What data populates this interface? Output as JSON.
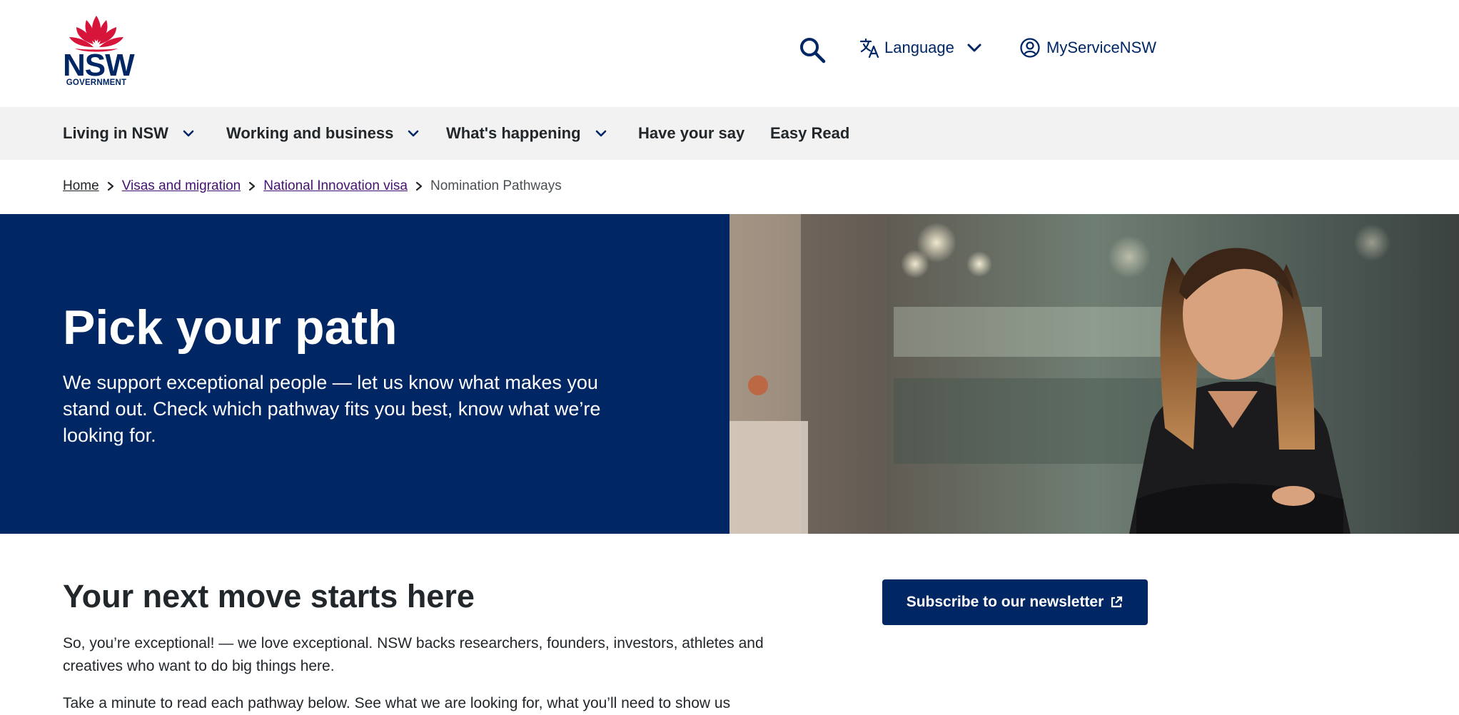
{
  "header": {
    "logo_text": "NSW",
    "logo_subtext": "GOVERNMENT",
    "language_label": "Language",
    "account_label": "MyServiceNSW"
  },
  "nav": {
    "items": [
      {
        "label": "Living in NSW",
        "has_dropdown": true
      },
      {
        "label": "Working and business",
        "has_dropdown": true
      },
      {
        "label": "What's happening",
        "has_dropdown": true
      },
      {
        "label": "Have your say",
        "has_dropdown": false
      },
      {
        "label": "Easy Read",
        "has_dropdown": false
      }
    ]
  },
  "breadcrumb": {
    "items": [
      "Home",
      "Visas and migration",
      "National Innovation visa"
    ],
    "current": "Nomination Pathways"
  },
  "hero": {
    "title": "Pick your path",
    "text": "We support exceptional people — let us know what makes you stand out. Check which pathway fits you best, know what we’re looking for."
  },
  "content": {
    "heading": "Your next move starts here",
    "paragraph1": "So, you’re exceptional!  — we love exceptional. NSW backs researchers, founders, investors, athletes and creatives who want to do big things here.",
    "paragraph2": "Take a minute to read each pathway below. See what we are looking for, what you’ll need to show us"
  },
  "sidebar": {
    "subscribe_label": "Subscribe to our newsletter"
  },
  "colors": {
    "brand_navy": "#002664",
    "waratah_red": "#d7153a",
    "nav_bg": "#f2f2f2",
    "visited_link": "#441170"
  }
}
